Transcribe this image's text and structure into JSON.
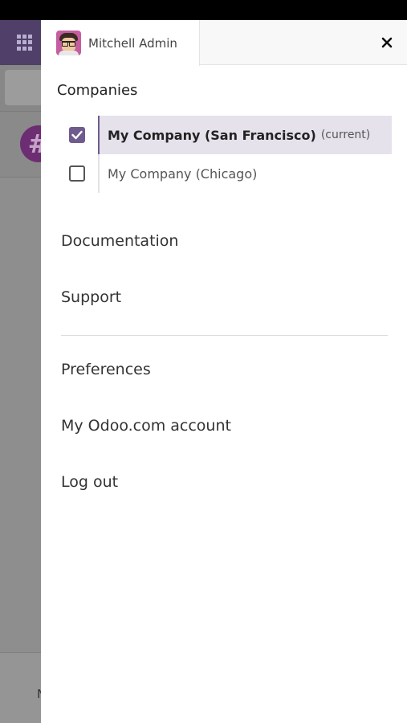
{
  "user": {
    "name": "Mitchell Admin"
  },
  "companies": {
    "title": "Companies",
    "items": [
      {
        "name": "My Company (San Francisco)",
        "tag": "(current)",
        "checked": true
      },
      {
        "name": "My Company (Chicago)",
        "tag": "",
        "checked": false
      }
    ]
  },
  "menu": {
    "documentation": "Documentation",
    "support": "Support",
    "preferences": "Preferences",
    "account": "My Odoo.com account",
    "logout": "Log out"
  },
  "background": {
    "channel_symbol": "#",
    "footer_letter": "N"
  },
  "icons": {
    "apps": "grid-icon",
    "close": "close-icon",
    "check": "checkmark-icon"
  },
  "colors": {
    "navbar": "#4f3f69",
    "accent": "#6f5b8e",
    "selected_row": "#e6e2ec"
  }
}
